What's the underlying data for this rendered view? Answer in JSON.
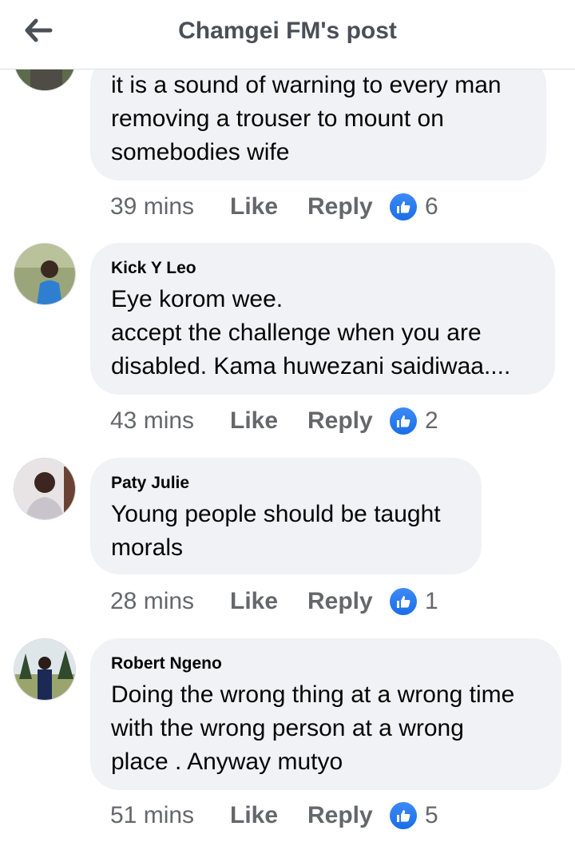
{
  "header": {
    "title": "Chamgei FM's post"
  },
  "colors": {
    "like_blue": "#1877f2",
    "bubble_bg": "#f0f2f5",
    "meta_gray": "#65676b"
  },
  "comments": [
    {
      "author": "",
      "text": "it is a sound of warning to every man\nremoving a trouser to mount on\nsomebodies wife",
      "time": "39 mins",
      "like_label": "Like",
      "reply_label": "Reply",
      "reactions": "6"
    },
    {
      "author": "Kick Y Leo",
      "text": "Eye korom wee.\naccept the challenge when you are\ndisabled. Kama huwezani saidiwaa....",
      "time": "43 mins",
      "like_label": "Like",
      "reply_label": "Reply",
      "reactions": "2"
    },
    {
      "author": "Paty Julie",
      "text": "Young people should be taught\nmorals",
      "time": "28 mins",
      "like_label": "Like",
      "reply_label": "Reply",
      "reactions": "1"
    },
    {
      "author": "Robert Ngeno",
      "text": "Doing the wrong thing at a wrong time\nwith the wrong person at a wrong\nplace . Anyway mutyo",
      "time": "51 mins",
      "like_label": "Like",
      "reply_label": "Reply",
      "reactions": "5"
    }
  ]
}
